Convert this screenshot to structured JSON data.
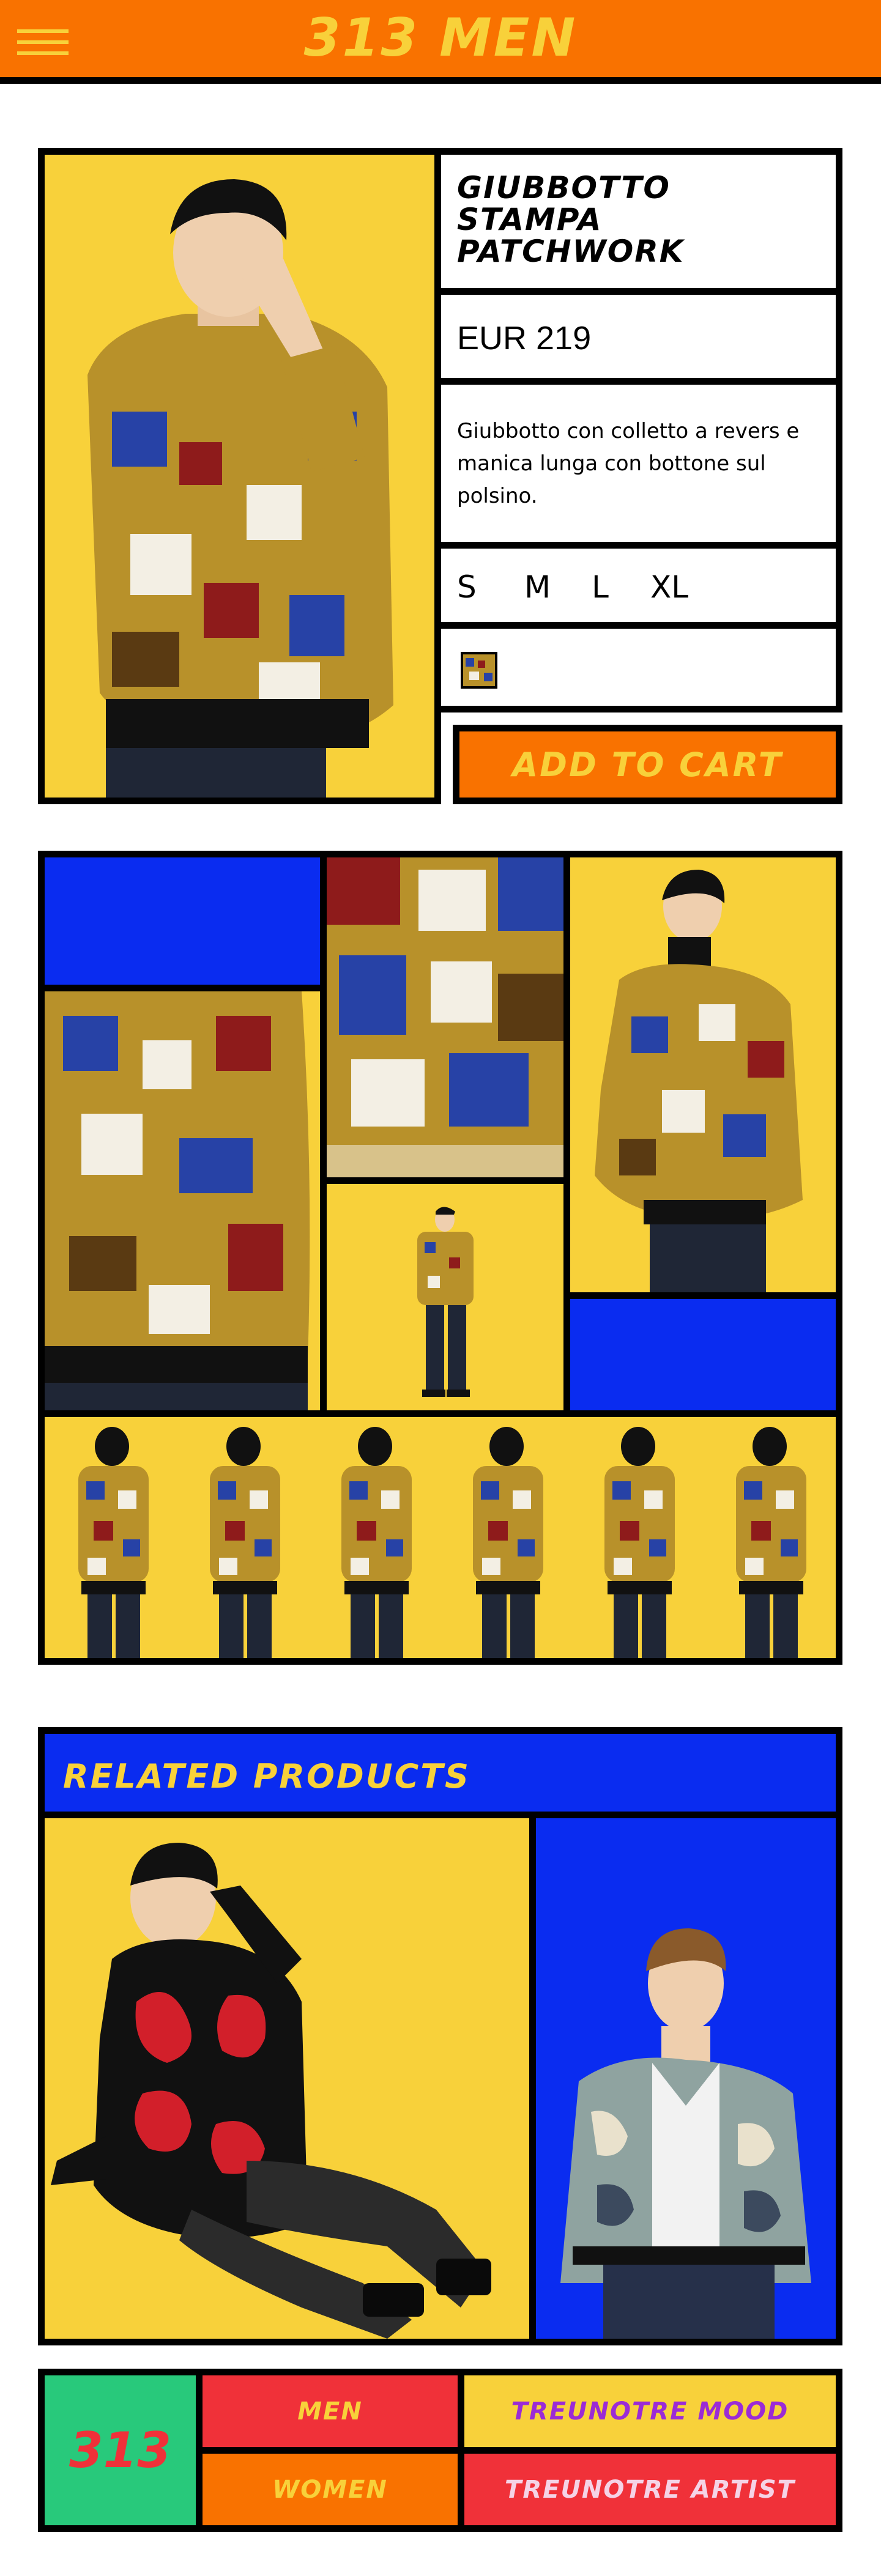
{
  "header": {
    "menu_icon": "hamburger-menu-icon",
    "logo": "313 MEN"
  },
  "product": {
    "title": "GIUBBOTTO STAMPA PATCHWORK",
    "price": "EUR 219",
    "description": "Giubbotto con colletto a revers e manica lunga con bottone sul polsino.",
    "sizes": [
      "S",
      "M",
      "L",
      "XL"
    ],
    "add_to_cart": "ADD TO CART"
  },
  "related": {
    "title": "RELATED PRODUCTS"
  },
  "footer": {
    "logo": "313",
    "links": {
      "men": "MEN",
      "women": "WOMEN",
      "mood": "TREUNOTRE MOOD",
      "artist": "TREUNOTRE ARTIST"
    }
  },
  "colors": {
    "orange": "#f97200",
    "yellow": "#f8d13a",
    "blue": "#0a2cf0",
    "red": "#f03139",
    "green": "#28c97b",
    "purple": "#9b2bd6"
  }
}
